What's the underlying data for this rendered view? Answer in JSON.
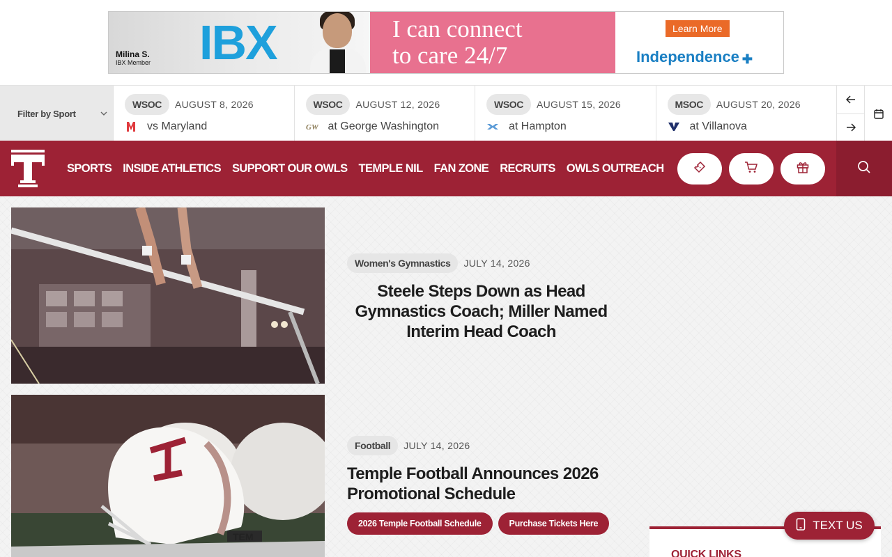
{
  "ad": {
    "person_name": "Milina S.",
    "person_caption": "IBX Member",
    "brand_mark": "IBX",
    "tagline_line1": "I can connect",
    "tagline_line2": "to care 24/7",
    "cta": "Learn More",
    "advertiser": "Independence"
  },
  "schedule": {
    "filter_label": "Filter by Sport",
    "games": [
      {
        "sport": "WSOC",
        "date": "AUGUST 8, 2026",
        "opponent": "vs Maryland",
        "logo_icon": "maryland-logo-icon"
      },
      {
        "sport": "WSOC",
        "date": "AUGUST 12, 2026",
        "opponent": "at George Washington",
        "logo_icon": "george-washington-logo-icon"
      },
      {
        "sport": "WSOC",
        "date": "AUGUST 15, 2026",
        "opponent": "at Hampton",
        "logo_icon": "hampton-logo-icon"
      },
      {
        "sport": "MSOC",
        "date": "AUGUST 20, 2026",
        "opponent": "at Villanova",
        "logo_icon": "villanova-logo-icon"
      }
    ]
  },
  "nav": {
    "items": [
      "SPORTS",
      "INSIDE ATHLETICS",
      "SUPPORT OUR OWLS",
      "TEMPLE NIL",
      "FAN ZONE",
      "RECRUITS",
      "OWLS OUTREACH"
    ]
  },
  "stories": [
    {
      "category": "Women's Gymnastics",
      "date": "JULY 14, 2026",
      "headline": "Steele Steps Down as Head Gymnastics Coach; Miller Named Interim Head Coach"
    },
    {
      "category": "Football",
      "date": "JULY 14, 2026",
      "headline": "Temple Football Announces 2026 Promotional Schedule",
      "buttons": [
        "2026 Temple Football Schedule",
        "Purchase Tickets Here"
      ]
    }
  ],
  "quick_links": {
    "title": "QUICK LINKS"
  },
  "text_us": {
    "label": "TEXT US"
  },
  "colors": {
    "brand": "#9d2235",
    "brand_dark": "#8b1d2f"
  }
}
